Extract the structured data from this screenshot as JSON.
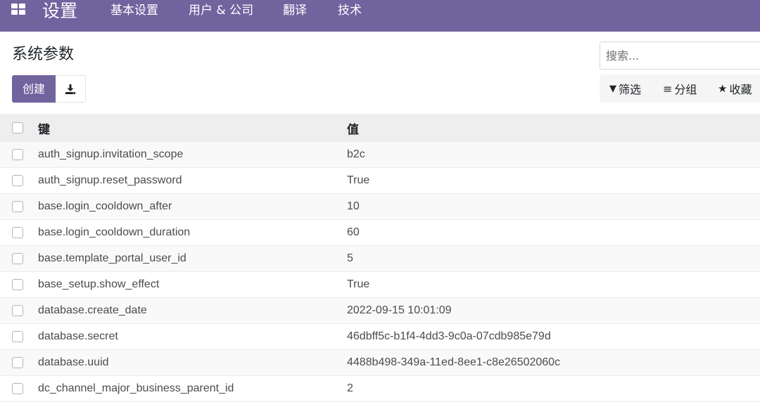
{
  "navbar": {
    "brand": "设置",
    "menu": [
      "基本设置",
      "用户 & 公司",
      "翻译",
      "技术"
    ],
    "color": "#71639e"
  },
  "control": {
    "title": "系统参数",
    "create_label": "创建",
    "download_icon": "download-icon",
    "search_placeholder": "搜索...",
    "filters": [
      {
        "icon": "filter-icon",
        "label": "筛选"
      },
      {
        "icon": "bars-icon",
        "label": "分组"
      },
      {
        "icon": "star-icon",
        "label": "收藏"
      }
    ]
  },
  "table": {
    "headers": {
      "key": "键",
      "value": "值"
    },
    "rows": [
      {
        "key": "auth_signup.invitation_scope",
        "value": "b2c"
      },
      {
        "key": "auth_signup.reset_password",
        "value": "True"
      },
      {
        "key": "base.login_cooldown_after",
        "value": "10"
      },
      {
        "key": "base.login_cooldown_duration",
        "value": "60"
      },
      {
        "key": "base.template_portal_user_id",
        "value": "5"
      },
      {
        "key": "base_setup.show_effect",
        "value": "True"
      },
      {
        "key": "database.create_date",
        "value": "2022-09-15 10:01:09"
      },
      {
        "key": "database.secret",
        "value": "46dbff5c-b1f4-4dd3-9c0a-07cdb985e79d"
      },
      {
        "key": "database.uuid",
        "value": "4488b498-349a-11ed-8ee1-c8e26502060c"
      },
      {
        "key": "dc_channel_major_business_parent_id",
        "value": "2"
      }
    ]
  }
}
